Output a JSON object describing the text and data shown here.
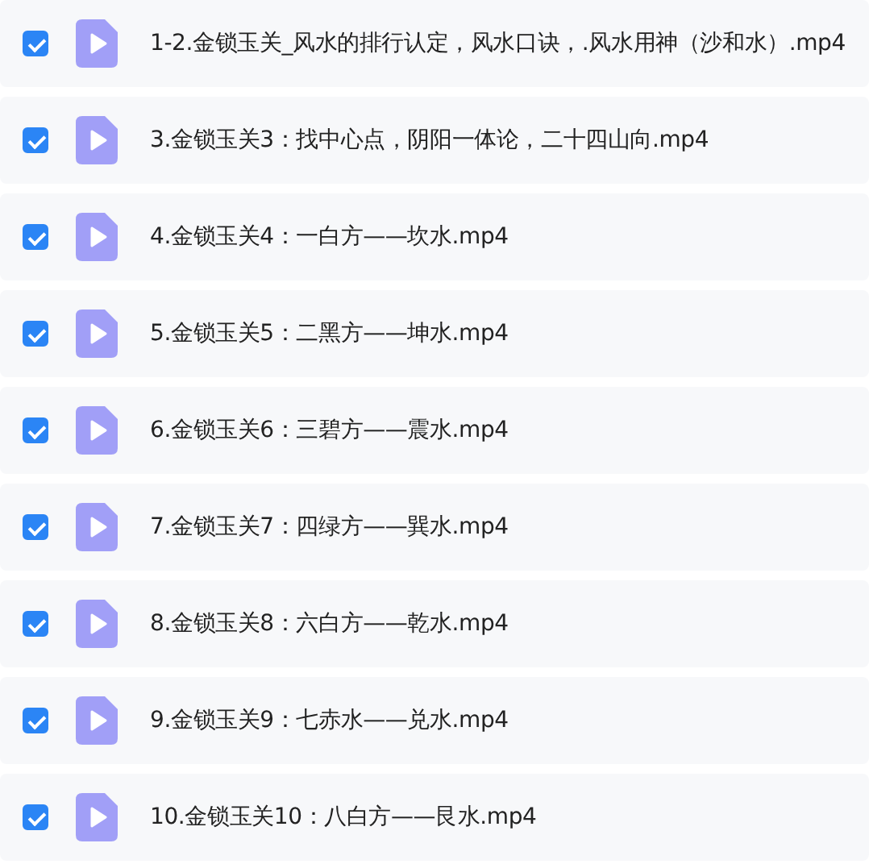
{
  "files": [
    {
      "name": "1-2.金锁玉关_风水的排行认定，风水口诀，.风水用神（沙和水）.mp4",
      "checked": true
    },
    {
      "name": "3.金锁玉关3：找中心点，阴阳一体论，二十四山向.mp4",
      "checked": true
    },
    {
      "name": "4.金锁玉关4：一白方——坎水.mp4",
      "checked": true
    },
    {
      "name": "5.金锁玉关5：二黑方——坤水.mp4",
      "checked": true
    },
    {
      "name": "6.金锁玉关6：三碧方——震水.mp4",
      "checked": true
    },
    {
      "name": "7.金锁玉关7：四绿方——巽水.mp4",
      "checked": true
    },
    {
      "name": "8.金锁玉关8：六白方——乾水.mp4",
      "checked": true
    },
    {
      "name": "9.金锁玉关9：七赤水——兑水.mp4",
      "checked": true
    },
    {
      "name": "10.金锁玉关10：八白方——艮水.mp4",
      "checked": true
    }
  ]
}
